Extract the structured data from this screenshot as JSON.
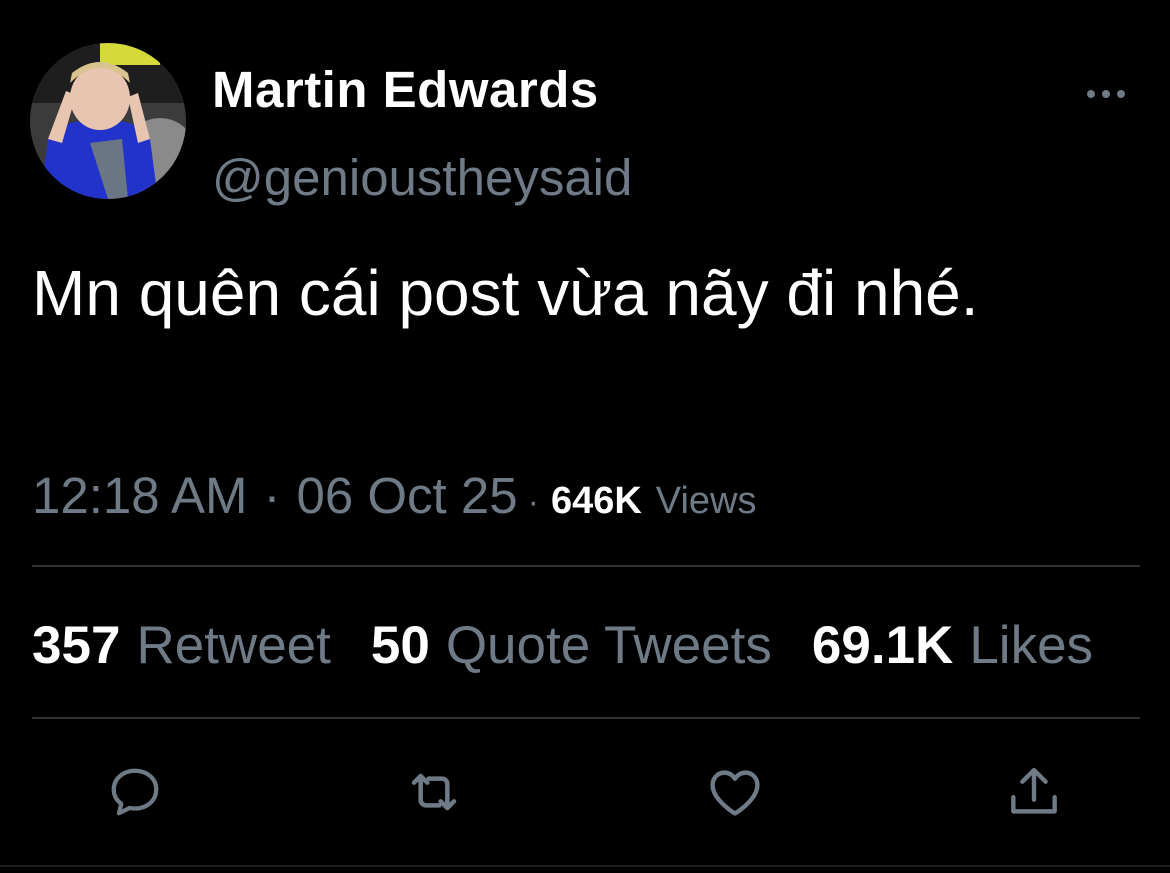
{
  "user": {
    "display_name": "Martin Edwards",
    "handle": "@genioustheysaid"
  },
  "tweet": {
    "text": "Mn quên cái post vừa nãy đi nhé.",
    "time": "12:18 AM",
    "separator": "·",
    "date": "06 Oct 25",
    "views_count": "646K",
    "views_label": "Views"
  },
  "stats": [
    {
      "count": "357",
      "label": "Retweet"
    },
    {
      "count": "50",
      "label": "Quote Tweets"
    },
    {
      "count": "69.1K",
      "label": "Likes"
    }
  ],
  "actions": [
    {
      "icon": "reply-icon"
    },
    {
      "icon": "retweet-icon"
    },
    {
      "icon": "like-icon"
    },
    {
      "icon": "share-icon"
    }
  ],
  "colors": {
    "background": "#000000",
    "primary_text": "#ffffff",
    "secondary_text": "#6e7a86",
    "divider": "#2f3336"
  }
}
